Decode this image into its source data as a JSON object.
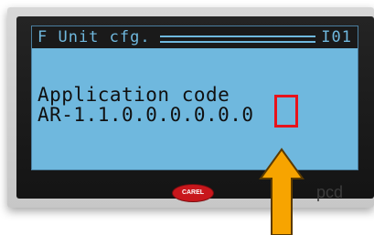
{
  "display": {
    "title": "F Unit cfg.",
    "screen_code": "I01",
    "line1": "Application code",
    "line2": "AR-1.1.0.0.0.0.0.0"
  },
  "device": {
    "brand_logo": "CAREL",
    "model_mark": "pcd"
  },
  "annotation": {
    "arrow_icon": "up-arrow-icon",
    "box_color": "#e8131b",
    "arrow_color": "#f7a400"
  },
  "colors": {
    "lcd_background": "#6fb8de",
    "lcd_text": "#101010",
    "bezel": "#1a1a1a"
  }
}
